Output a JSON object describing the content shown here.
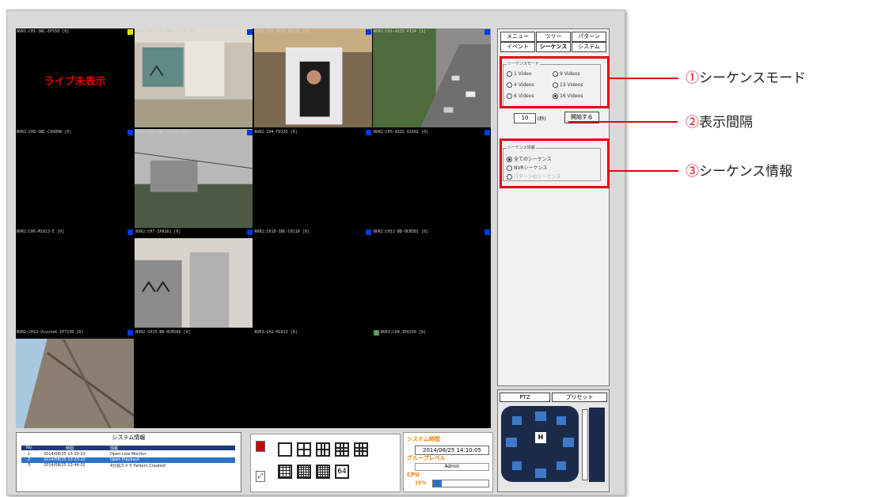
{
  "cameras": [
    {
      "label": "NVR1:CH1-SNC-EP550 [0]",
      "marker": "#e6e600"
    },
    {
      "label": "NVR1:CH2-VB-S30D/10.0 [4]",
      "marker": "#0039e6"
    },
    {
      "label": "NVR1:CH3-AXIS M5013 [1]",
      "marker": "#0039e6"
    },
    {
      "label": "NVR1:CH1-AXIS P134 [1]",
      "marker": "#0039e6"
    },
    {
      "label": "NVR2:CH8-SNC-CX600W [0]",
      "marker": "#0039e6"
    },
    {
      "label": "NVR2:CH3-SNC-CH240 [11]",
      "marker": "#0039e6"
    },
    {
      "label": "NVR2:CH4-F9135 [0]",
      "marker": "#0039e6"
    },
    {
      "label": "NVR2:CH5-AXIS Q1602 [0]",
      "marker": "#0039e6"
    },
    {
      "label": "NVR2:CH6-M1013-E [0]",
      "marker": "#0039e6"
    },
    {
      "label": "NVR2:CH7-IP8161 [0]",
      "marker": "#0039e6"
    },
    {
      "label": "NVR2:CH10-SNC-CH110 [0]",
      "marker": "#0039e6"
    },
    {
      "label": "NVR2:CH11-BB-HCM381 [0]",
      "marker": "#0039e6"
    },
    {
      "label": "NVR2:CH13-Vivotek IP7130 [0]",
      "marker": "#0039e6"
    },
    {
      "label": "NVR2:CH15-BB-HCM100 [0]",
      "marker": "#0039e6"
    },
    {
      "label": "NVR3:CH2-M1013 [0]",
      "marker": "#0039e6"
    },
    {
      "label": "NVR3:CH4-IP8330 [0]",
      "marker": "#5a9a5a"
    }
  ],
  "live_not_shown": "ライブ未表示",
  "tabs": {
    "menu": "メニュー",
    "tree": "ツリー",
    "pattern": "パターン",
    "event": "イベント",
    "sequence": "シーケンス",
    "system": "システム"
  },
  "sequence_mode": {
    "title": "シーケンスモード",
    "options": [
      "1 Video",
      "9 Videos",
      "4 Videos",
      "13 Videos",
      "6 Videos",
      "16 Videos"
    ],
    "selected": "16 Videos"
  },
  "interval": {
    "value": "10",
    "unit": "(秒)",
    "start_button": "開始する"
  },
  "sequence_info": {
    "title": "シーケンス情報",
    "options": [
      "全てのシーケンス",
      "NVRシーケンス",
      "パターンのシーケンス"
    ],
    "selected": "全てのシーケンス"
  },
  "callouts": [
    {
      "num": "①",
      "text": "シーケンスモード"
    },
    {
      "num": "②",
      "text": "表示間隔"
    },
    {
      "num": "③",
      "text": "シーケンス情報"
    }
  ],
  "system_info": {
    "title": "システム情報",
    "columns": [
      "No.",
      "時間",
      "情報"
    ],
    "rows": [
      {
        "no": "1",
        "time": "2014/08/25 13:23:23",
        "info": "Open Live Monitor"
      },
      {
        "no": "2",
        "time": "2014/08/25 13:23:22",
        "info": "Open Playback"
      },
      {
        "no": "3",
        "time": "2014/08/25 13:44:02",
        "info": "4分割カメラ Pattern Created!"
      }
    ],
    "selected_row": 1
  },
  "system_time": {
    "title": "システム時間",
    "value": "2014/08/25 14:10:05",
    "group_label": "グループレベル",
    "user": "Admin",
    "cpu_label": "CPU",
    "cpu_value": "15%",
    "cpu_fraction": 0.15
  },
  "ptz": {
    "tab_ptz": "PTZ",
    "tab_preset": "プリセット",
    "home": "H"
  },
  "layout": {
    "last_icon": "64"
  },
  "colors": {
    "accent_red": "#e60012",
    "marker_blue": "#0039e6",
    "log_selected": "#2d72c9"
  }
}
